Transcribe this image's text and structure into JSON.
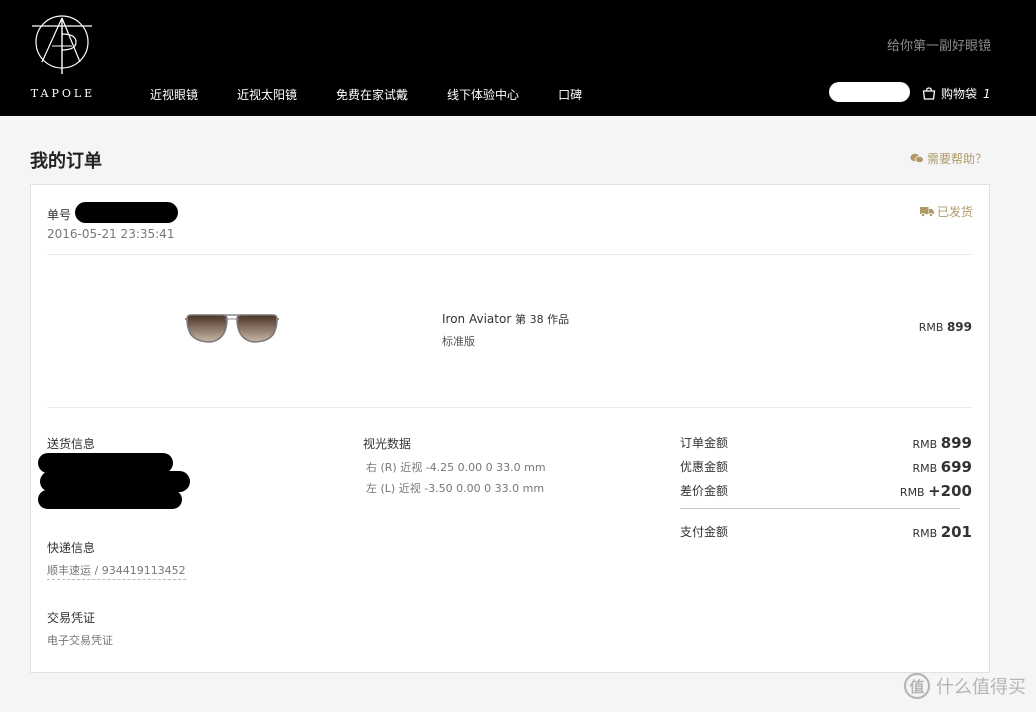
{
  "header": {
    "brand": "TAPOLE",
    "slogan": "给你第一副好眼镜",
    "nav": [
      "近视眼镜",
      "近视太阳镜",
      "免费在家试戴",
      "线下体验中心",
      "口碑"
    ],
    "cart_label": "购物袋",
    "cart_count": "1"
  },
  "page": {
    "title": "我的订单",
    "help_label": "需要帮助？"
  },
  "order": {
    "number_label": "单号",
    "datetime": "2016-05-21 23:35:41",
    "status": "已发货",
    "product": {
      "name": "Iron Aviator",
      "series": "第 38 作品",
      "variant": "标准版",
      "currency": "RMB",
      "price": "899"
    },
    "delivery_label": "送货信息",
    "express_label": "快递信息",
    "express_value": "顺丰速运 / 934419113452",
    "receipt_label": "交易凭证",
    "receipt_value": "电子交易凭证",
    "prescription_label": "视光数据",
    "prescription_right": "右 (R) 近视 -4.25 0.00 0 33.0 mm",
    "prescription_left": "左 (L) 近视 -3.50 0.00 0 33.0 mm",
    "summary": {
      "order_amount_label": "订单金额",
      "order_amount": "899",
      "discount_label": "优惠金额",
      "discount": "699",
      "diff_label": "差价金额",
      "diff": "+200",
      "paid_label": "支付金额",
      "paid": "201",
      "currency": "RMB"
    }
  },
  "watermark": "什么值得买",
  "colors": {
    "header_bg": "#000000",
    "accent_gold": "#b09a68",
    "page_bg": "#f4f5f7"
  }
}
